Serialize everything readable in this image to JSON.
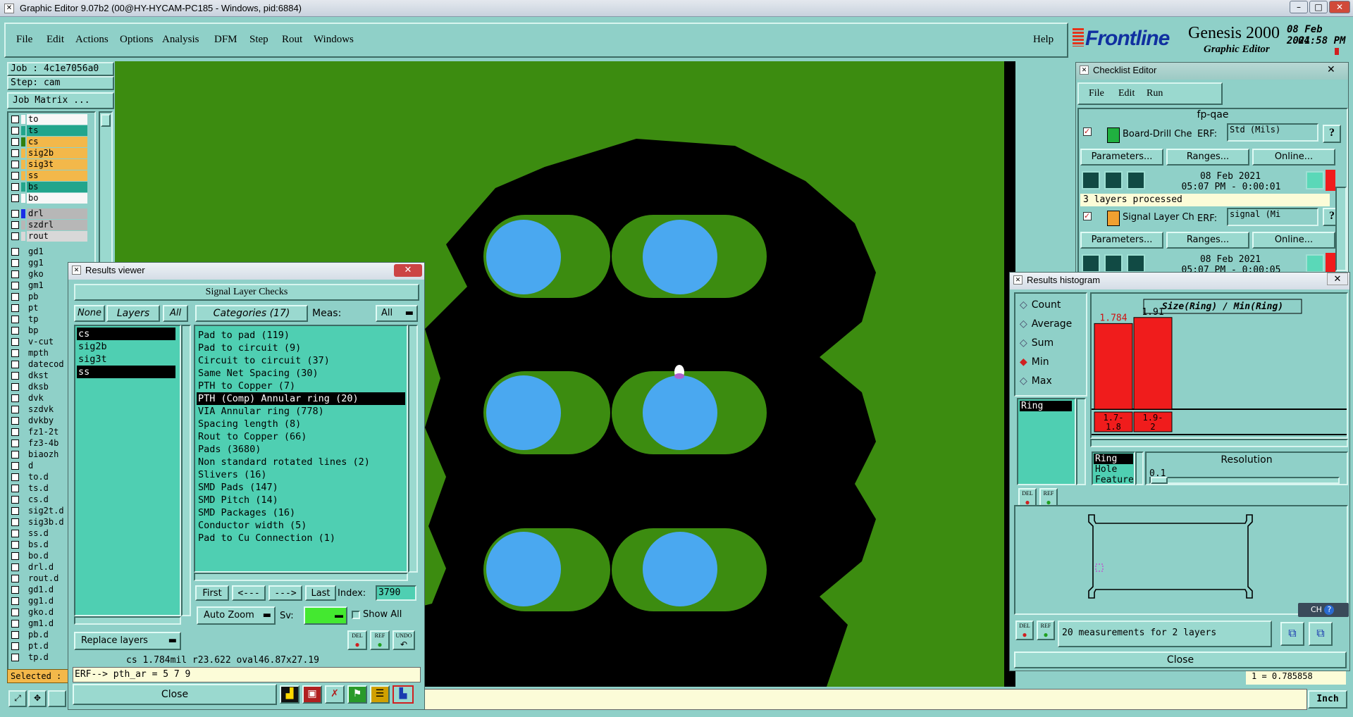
{
  "window": {
    "title": "Graphic Editor 9.07b2 (00@HY-HYCAM-PC185 - Windows, pid:6884)"
  },
  "menu": {
    "items": [
      "File",
      "Edit",
      "Actions",
      "Options",
      "Analysis",
      "DFM",
      "Step",
      "Rout",
      "Windows"
    ],
    "help": "Help"
  },
  "brand": {
    "logo": "Frontline",
    "product": "Genesis 2000",
    "subtitle": "Graphic Editor",
    "date": "08 Feb 2021",
    "time": "04:58 PM"
  },
  "job": {
    "job_label": "Job : 4c1e7056a0",
    "step_label": "Step: cam",
    "matrix_button": "Job Matrix ..."
  },
  "layers": [
    {
      "name": "to",
      "color": "#f7f7f7",
      "sw": "#f7f7f7"
    },
    {
      "name": "ts",
      "color": "#22a58c",
      "sw": "#22a58c"
    },
    {
      "name": "cs",
      "color": "#f3b84a",
      "sw": "#2f7f0f"
    },
    {
      "name": "sig2b",
      "color": "#f3b84a",
      "sw": "#f3b84a"
    },
    {
      "name": "sig3t",
      "color": "#f3b84a",
      "sw": "#f3b84a"
    },
    {
      "name": "ss",
      "color": "#f3b84a",
      "sw": "#f3b84a"
    },
    {
      "name": "bs",
      "color": "#22a58c",
      "sw": "#22a58c"
    },
    {
      "name": "bo",
      "color": "#f7f7f7",
      "sw": "#f7f7f7"
    },
    {
      "name": "drl",
      "color": "#b7b7b7",
      "sw": "#1a2ee6"
    },
    {
      "name": "szdrl",
      "color": "#b7b7b7",
      "sw": "#b7b7b7"
    },
    {
      "name": "rout",
      "color": "#d8d8d8",
      "sw": "#d8d8d8"
    },
    {
      "name": "gd1",
      "color": "#8fd0c8",
      "sw": "#8fd0c8"
    },
    {
      "name": "gg1",
      "color": "#8fd0c8",
      "sw": "#8fd0c8"
    },
    {
      "name": "gko",
      "color": "#8fd0c8",
      "sw": "#8fd0c8"
    },
    {
      "name": "gm1",
      "color": "#8fd0c8",
      "sw": "#8fd0c8"
    },
    {
      "name": "pb",
      "color": "#8fd0c8",
      "sw": "#8fd0c8"
    },
    {
      "name": "pt",
      "color": "#8fd0c8",
      "sw": "#8fd0c8"
    },
    {
      "name": "tp",
      "color": "#8fd0c8",
      "sw": "#8fd0c8"
    },
    {
      "name": "bp",
      "color": "#8fd0c8",
      "sw": "#8fd0c8"
    },
    {
      "name": "v-cut",
      "color": "#8fd0c8",
      "sw": "#8fd0c8"
    },
    {
      "name": "mpth",
      "color": "#8fd0c8",
      "sw": "#8fd0c8"
    },
    {
      "name": "datecod",
      "color": "#8fd0c8",
      "sw": "#8fd0c8"
    },
    {
      "name": "dkst",
      "color": "#8fd0c8",
      "sw": "#8fd0c8"
    },
    {
      "name": "dksb",
      "color": "#8fd0c8",
      "sw": "#8fd0c8"
    },
    {
      "name": "dvk",
      "color": "#8fd0c8",
      "sw": "#8fd0c8"
    },
    {
      "name": "szdvk",
      "color": "#8fd0c8",
      "sw": "#8fd0c8"
    },
    {
      "name": "dvkby",
      "color": "#8fd0c8",
      "sw": "#8fd0c8"
    },
    {
      "name": "fz1-2t",
      "color": "#8fd0c8",
      "sw": "#8fd0c8"
    },
    {
      "name": "fz3-4b",
      "color": "#8fd0c8",
      "sw": "#8fd0c8"
    },
    {
      "name": "biaozh",
      "color": "#8fd0c8",
      "sw": "#8fd0c8"
    },
    {
      "name": "d",
      "color": "#8fd0c8",
      "sw": "#8fd0c8"
    },
    {
      "name": "to.d",
      "color": "#8fd0c8",
      "sw": "#8fd0c8"
    },
    {
      "name": "ts.d",
      "color": "#8fd0c8",
      "sw": "#8fd0c8"
    },
    {
      "name": "cs.d",
      "color": "#8fd0c8",
      "sw": "#8fd0c8"
    },
    {
      "name": "sig2t.d",
      "color": "#8fd0c8",
      "sw": "#8fd0c8"
    },
    {
      "name": "sig3b.d",
      "color": "#8fd0c8",
      "sw": "#8fd0c8"
    },
    {
      "name": "ss.d",
      "color": "#8fd0c8",
      "sw": "#8fd0c8"
    },
    {
      "name": "bs.d",
      "color": "#8fd0c8",
      "sw": "#8fd0c8"
    },
    {
      "name": "bo.d",
      "color": "#8fd0c8",
      "sw": "#8fd0c8"
    },
    {
      "name": "drl.d",
      "color": "#8fd0c8",
      "sw": "#8fd0c8"
    },
    {
      "name": "rout.d",
      "color": "#8fd0c8",
      "sw": "#8fd0c8"
    },
    {
      "name": "gd1.d",
      "color": "#8fd0c8",
      "sw": "#8fd0c8"
    },
    {
      "name": "gg1.d",
      "color": "#8fd0c8",
      "sw": "#8fd0c8"
    },
    {
      "name": "gko.d",
      "color": "#8fd0c8",
      "sw": "#8fd0c8"
    },
    {
      "name": "gm1.d",
      "color": "#8fd0c8",
      "sw": "#8fd0c8"
    },
    {
      "name": "pb.d",
      "color": "#8fd0c8",
      "sw": "#8fd0c8"
    },
    {
      "name": "pt.d",
      "color": "#8fd0c8",
      "sw": "#8fd0c8"
    },
    {
      "name": "tp.d",
      "color": "#8fd0c8",
      "sw": "#8fd0c8"
    }
  ],
  "status": {
    "selected": "Selected :",
    "units": "Inch",
    "coord": "1 = 0.785858"
  },
  "results_viewer": {
    "title": "Results viewer",
    "header": "Signal Layer Checks",
    "none_btn": "None",
    "layers_btn": "Layers",
    "all_btn": "All",
    "layers": [
      "cs",
      "sig2b",
      "sig3t",
      "ss"
    ],
    "categories_btn": "Categories (17)",
    "meas_label": "Meas:",
    "meas_value": "All",
    "categories": [
      "Pad to pad (119)",
      "Pad to circuit (9)",
      "Circuit to circuit (37)",
      "Same Net Spacing (30)",
      "PTH to Copper (7)",
      "PTH (Comp) Annular ring (20)",
      "VIA Annular ring (778)",
      "Spacing length (8)",
      "Rout to Copper (66)",
      "Pads (3680)",
      "Non standard rotated lines (2)",
      "Slivers (16)",
      "SMD Pads (147)",
      "SMD Pitch (14)",
      "SMD Packages (16)",
      "Conductor width (5)",
      "Pad to Cu Connection (1)"
    ],
    "selected_category": "PTH (Comp) Annular ring (20)",
    "first": "First",
    "prev": "<---",
    "next": "--->",
    "last": "Last",
    "index_label": "Index:",
    "index_value": "3790",
    "zoom": "Auto Zoom",
    "sv_label": "Sv:",
    "show_all": "Show All",
    "replace": "Replace layers",
    "del": "DEL",
    "ref": "REF",
    "undo": "UNDO",
    "info": "cs 1.784mil  r23.622  oval46.87x27.19",
    "erf": "ERF--> pth_ar = 5 7 9",
    "close": "Close"
  },
  "checklist": {
    "title": "Checklist Editor",
    "menu": [
      "File",
      "Edit",
      "Run"
    ],
    "name": "fp-qae",
    "item1": {
      "name": "Board-Drill Che",
      "erf": "ERF:",
      "erf_value": "Std (Mils)",
      "date": "08 Feb 2021",
      "time": "05:07 PM - 0:00:01",
      "status": "3 layers processed"
    },
    "item2": {
      "name": "Signal Layer Ch",
      "erf": "ERF:",
      "erf_value": "signal (Mi",
      "date": "08 Feb 2021",
      "time": "05:07 PM - 0:00:05"
    },
    "params": "Parameters...",
    "ranges": "Ranges...",
    "online": "Online...",
    "help": "?"
  },
  "histogram": {
    "title": "Results histogram",
    "options": [
      "Count",
      "Average",
      "Sum",
      "Min",
      "Max"
    ],
    "selected_option": "Min",
    "chart_title": "Size(Ring) / Min(Ring)",
    "list_item": "Ring",
    "attr_items": [
      "Ring",
      "Hole",
      "Feature"
    ],
    "resolution_label": "Resolution",
    "resolution_value": "0.1",
    "summary": "20 measurements for 2 layers",
    "close": "Close",
    "del": "DEL",
    "ref": "REF"
  },
  "chart_data": {
    "type": "bar",
    "categories": [
      "1.7-1.8",
      "1.9-2"
    ],
    "values": [
      1.784,
      1.91
    ],
    "title": "Size(Ring) / Min(Ring)",
    "xlabel": "",
    "ylabel": "",
    "color": "#f01c1c"
  },
  "colors": {
    "board": "#3c8c10",
    "copper": "#000000",
    "pad": "#4aa8f0",
    "panel": "#8fd0c8",
    "teal": "#4fcfb2"
  }
}
